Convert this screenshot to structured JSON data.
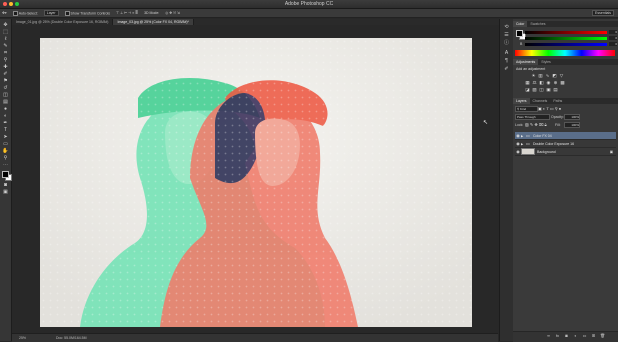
{
  "app": {
    "title": "Adobe Photoshop CC",
    "workspace": "Essentials"
  },
  "options_bar": {
    "auto_select_label": "Auto-Select:",
    "auto_select_value": "Layer",
    "transform_label": "Show Transform Controls",
    "mode_label": "3D Mode:"
  },
  "tabs": [
    {
      "label": "Image_01.jpg @ 25% (Double Color Exposure 16, RGB/8#)"
    },
    {
      "label": "Image_03.jpg @ 25% (Color FX 04, RGB/8#)*"
    }
  ],
  "color_panel": {
    "tabs": [
      "Color",
      "Swatches"
    ],
    "sliders": [
      {
        "label": "R",
        "value": "0",
        "color": "#e23a3a"
      },
      {
        "label": "G",
        "value": "0",
        "color": "#3ae26a"
      },
      {
        "label": "B",
        "value": "0",
        "color": "#4a7ae2"
      }
    ]
  },
  "adjustments_panel": {
    "tabs": [
      "Adjustments",
      "Styles"
    ],
    "heading": "Add an adjustment"
  },
  "layers_panel": {
    "tabs": [
      "Layers",
      "Channels",
      "Paths"
    ],
    "kind_filter": "Kind",
    "blend_mode": "Pass Through",
    "opacity_label": "Opacity:",
    "opacity": "100%",
    "lock_label": "Lock:",
    "fill_label": "Fill:",
    "fill": "100%",
    "layers": [
      {
        "name": "Color FX 04",
        "selected": true
      },
      {
        "name": "Double Color Exposure 16",
        "selected": false
      },
      {
        "name": "Background",
        "selected": false
      }
    ]
  },
  "status_bar": {
    "zoom": "25%",
    "doc_size": "Doc: 55.0M/164.5M"
  },
  "colors": {
    "accent": "#5a6e8a",
    "foreground": "#000000",
    "background": "#ffffff"
  }
}
